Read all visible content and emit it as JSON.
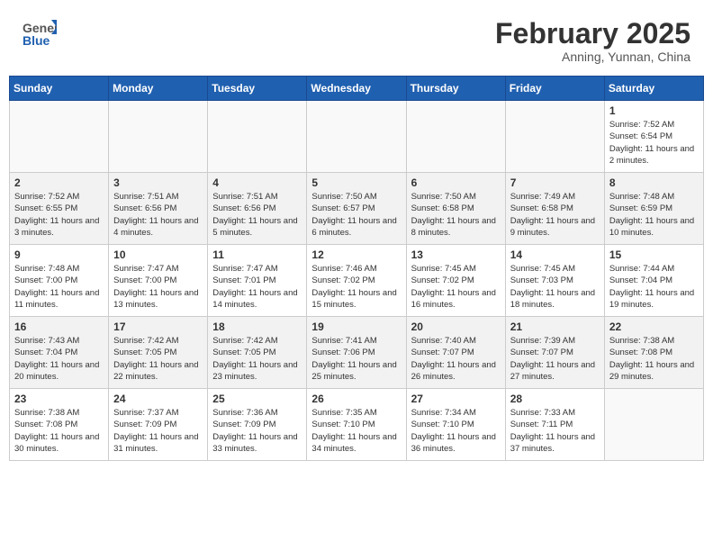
{
  "header": {
    "logo_general": "General",
    "logo_blue": "Blue",
    "month_title": "February 2025",
    "location": "Anning, Yunnan, China"
  },
  "weekdays": [
    "Sunday",
    "Monday",
    "Tuesday",
    "Wednesday",
    "Thursday",
    "Friday",
    "Saturday"
  ],
  "weeks": [
    [
      {
        "day": "",
        "empty": true
      },
      {
        "day": "",
        "empty": true
      },
      {
        "day": "",
        "empty": true
      },
      {
        "day": "",
        "empty": true
      },
      {
        "day": "",
        "empty": true
      },
      {
        "day": "",
        "empty": true
      },
      {
        "day": "1",
        "sunrise": "7:52 AM",
        "sunset": "6:54 PM",
        "daylight": "11 hours and 2 minutes."
      }
    ],
    [
      {
        "day": "2",
        "sunrise": "7:52 AM",
        "sunset": "6:55 PM",
        "daylight": "11 hours and 3 minutes."
      },
      {
        "day": "3",
        "sunrise": "7:51 AM",
        "sunset": "6:56 PM",
        "daylight": "11 hours and 4 minutes."
      },
      {
        "day": "4",
        "sunrise": "7:51 AM",
        "sunset": "6:56 PM",
        "daylight": "11 hours and 5 minutes."
      },
      {
        "day": "5",
        "sunrise": "7:50 AM",
        "sunset": "6:57 PM",
        "daylight": "11 hours and 6 minutes."
      },
      {
        "day": "6",
        "sunrise": "7:50 AM",
        "sunset": "6:58 PM",
        "daylight": "11 hours and 8 minutes."
      },
      {
        "day": "7",
        "sunrise": "7:49 AM",
        "sunset": "6:58 PM",
        "daylight": "11 hours and 9 minutes."
      },
      {
        "day": "8",
        "sunrise": "7:48 AM",
        "sunset": "6:59 PM",
        "daylight": "11 hours and 10 minutes."
      }
    ],
    [
      {
        "day": "9",
        "sunrise": "7:48 AM",
        "sunset": "7:00 PM",
        "daylight": "11 hours and 11 minutes."
      },
      {
        "day": "10",
        "sunrise": "7:47 AM",
        "sunset": "7:00 PM",
        "daylight": "11 hours and 13 minutes."
      },
      {
        "day": "11",
        "sunrise": "7:47 AM",
        "sunset": "7:01 PM",
        "daylight": "11 hours and 14 minutes."
      },
      {
        "day": "12",
        "sunrise": "7:46 AM",
        "sunset": "7:02 PM",
        "daylight": "11 hours and 15 minutes."
      },
      {
        "day": "13",
        "sunrise": "7:45 AM",
        "sunset": "7:02 PM",
        "daylight": "11 hours and 16 minutes."
      },
      {
        "day": "14",
        "sunrise": "7:45 AM",
        "sunset": "7:03 PM",
        "daylight": "11 hours and 18 minutes."
      },
      {
        "day": "15",
        "sunrise": "7:44 AM",
        "sunset": "7:04 PM",
        "daylight": "11 hours and 19 minutes."
      }
    ],
    [
      {
        "day": "16",
        "sunrise": "7:43 AM",
        "sunset": "7:04 PM",
        "daylight": "11 hours and 20 minutes."
      },
      {
        "day": "17",
        "sunrise": "7:42 AM",
        "sunset": "7:05 PM",
        "daylight": "11 hours and 22 minutes."
      },
      {
        "day": "18",
        "sunrise": "7:42 AM",
        "sunset": "7:05 PM",
        "daylight": "11 hours and 23 minutes."
      },
      {
        "day": "19",
        "sunrise": "7:41 AM",
        "sunset": "7:06 PM",
        "daylight": "11 hours and 25 minutes."
      },
      {
        "day": "20",
        "sunrise": "7:40 AM",
        "sunset": "7:07 PM",
        "daylight": "11 hours and 26 minutes."
      },
      {
        "day": "21",
        "sunrise": "7:39 AM",
        "sunset": "7:07 PM",
        "daylight": "11 hours and 27 minutes."
      },
      {
        "day": "22",
        "sunrise": "7:38 AM",
        "sunset": "7:08 PM",
        "daylight": "11 hours and 29 minutes."
      }
    ],
    [
      {
        "day": "23",
        "sunrise": "7:38 AM",
        "sunset": "7:08 PM",
        "daylight": "11 hours and 30 minutes."
      },
      {
        "day": "24",
        "sunrise": "7:37 AM",
        "sunset": "7:09 PM",
        "daylight": "11 hours and 31 minutes."
      },
      {
        "day": "25",
        "sunrise": "7:36 AM",
        "sunset": "7:09 PM",
        "daylight": "11 hours and 33 minutes."
      },
      {
        "day": "26",
        "sunrise": "7:35 AM",
        "sunset": "7:10 PM",
        "daylight": "11 hours and 34 minutes."
      },
      {
        "day": "27",
        "sunrise": "7:34 AM",
        "sunset": "7:10 PM",
        "daylight": "11 hours and 36 minutes."
      },
      {
        "day": "28",
        "sunrise": "7:33 AM",
        "sunset": "7:11 PM",
        "daylight": "11 hours and 37 minutes."
      },
      {
        "day": "",
        "empty": true
      }
    ]
  ]
}
